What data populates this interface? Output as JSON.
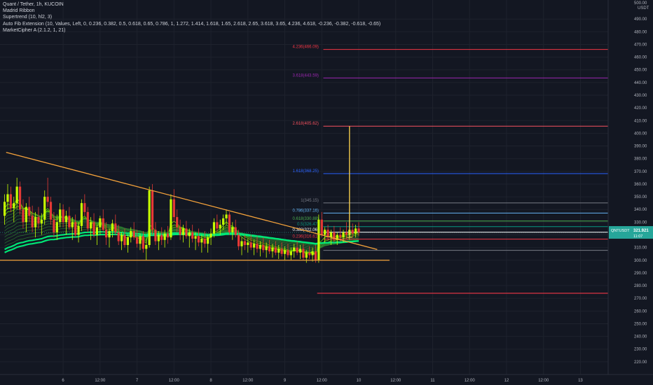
{
  "header": {
    "symbol_line": "Quant / Tether, 1h, KUCOIN",
    "indicators": [
      "Madrid Ribbon",
      "Supertrend (10, hl2, 3)",
      "Auto Fib Extension (10, Values, Left, 0, 0.236, 0.382, 0.5, 0.618, 0.65, 0.786, 1, 1.272, 1.414, 1.618, 1.65, 2.618, 2.65, 3.618, 3.65, 4.236, 4.618, -0.236, -0.382, -0.618, -0.65)",
      "MarketCipher A (2.1.2, 1, 21)"
    ]
  },
  "price_axis": {
    "currency": "USDT",
    "top_label": "500.00",
    "last_price_symbol": "QNTUSDT",
    "last_price": "321.921",
    "countdown": "11:07",
    "last_price_color": "#26a69a"
  },
  "chart_data": {
    "type": "candlestick",
    "ylim": [
      210,
      505
    ],
    "y_ticks": [
      220,
      230,
      240,
      250,
      260,
      270,
      280,
      290,
      300,
      310,
      320,
      330,
      340,
      350,
      360,
      370,
      380,
      390,
      400,
      410,
      420,
      430,
      440,
      450,
      460,
      470,
      480,
      490
    ],
    "x_tick_labels": [
      "6",
      "12:00",
      "7",
      "12:00",
      "8",
      "12:00",
      "9",
      "12:00",
      "10",
      "12:00",
      "11",
      "12:00",
      "12",
      "12:00",
      "13"
    ],
    "x_range_hours": [
      -20.5,
      177
    ],
    "x_ticks_hours": [
      0,
      12,
      24,
      36,
      48,
      60,
      72,
      84,
      96,
      108,
      120,
      132,
      144,
      156,
      168
    ],
    "fib_levels": [
      {
        "ratio": "4.236",
        "price": 466.09,
        "label": "4.236(466.09)",
        "color": "#f23645"
      },
      {
        "ratio": "3.618",
        "price": 443.59,
        "label": "3.618(443.59)",
        "color": "#9c27b0"
      },
      {
        "ratio": "2.618",
        "price": 405.62,
        "label": "2.618(405.62)",
        "color": "#f7525f"
      },
      {
        "ratio": "1.618",
        "price": 368.25,
        "label": "1.618(368.25)",
        "color": "#2962ff"
      },
      {
        "ratio": "1",
        "price": 345.15,
        "label": "1(345.15)",
        "color": "#787b86"
      },
      {
        "ratio": "0.786",
        "price": 337.16,
        "label": "0.786(337.16)",
        "color": "#64b5f6"
      },
      {
        "ratio": "0.618",
        "price": 330.88,
        "label": "0.618(330.88)",
        "color": "#4caf50"
      },
      {
        "ratio": "0.5",
        "price": 326.47,
        "label": "0.5(326.47)",
        "color": "#089981"
      },
      {
        "ratio": "0.382",
        "price": 322.06,
        "label": "0.382(322.06)",
        "color": "#ffffff"
      },
      {
        "ratio": "0.236",
        "price": 316.61,
        "label": "0.236(316.61)",
        "color": "#f23645"
      },
      {
        "ratio": "0",
        "price": 307.8,
        "label": "",
        "color": "#787b86"
      }
    ],
    "support_line": {
      "price": 274,
      "start_hour": 82.5,
      "end_hour": 177,
      "color": "#f23645"
    },
    "trendline_upper": {
      "from": [
        -18.5,
        385
      ],
      "to": [
        102,
        308.5
      ],
      "color": "#f6a33b"
    },
    "trendline_lower": {
      "from": [
        -20.5,
        300
      ],
      "to": [
        106,
        300
      ],
      "color": "#f6a33b"
    },
    "projection_line": {
      "hour": 93,
      "from": 318,
      "to": 405.6,
      "color": "#ffd54f"
    },
    "candles": [
      [
        -19,
        335,
        352,
        328,
        346
      ],
      [
        -18,
        346,
        360,
        340,
        352
      ],
      [
        -17,
        352,
        358,
        338,
        341
      ],
      [
        -16,
        341,
        350,
        330,
        345
      ],
      [
        -15,
        345,
        365,
        340,
        358
      ],
      [
        -14,
        358,
        362,
        336,
        340
      ],
      [
        -13,
        340,
        348,
        325,
        330
      ],
      [
        -12,
        330,
        345,
        322,
        342
      ],
      [
        -11,
        342,
        350,
        330,
        335
      ],
      [
        -10,
        335,
        343,
        322,
        326
      ],
      [
        -9,
        326,
        338,
        318,
        334
      ],
      [
        -8,
        334,
        342,
        325,
        329
      ],
      [
        -7,
        329,
        337,
        320,
        332
      ],
      [
        -6,
        332,
        355,
        328,
        350
      ],
      [
        -5,
        350,
        365,
        342,
        346
      ],
      [
        -4,
        346,
        350,
        328,
        332
      ],
      [
        -3,
        332,
        338,
        318,
        322
      ],
      [
        -2,
        322,
        336,
        316,
        330
      ],
      [
        -1,
        330,
        345,
        326,
        340
      ],
      [
        0,
        340,
        344,
        326,
        330
      ],
      [
        1,
        330,
        339,
        320,
        335
      ],
      [
        2,
        335,
        342,
        324,
        326
      ],
      [
        3,
        326,
        334,
        316,
        330
      ],
      [
        4,
        330,
        336,
        318,
        320
      ],
      [
        5,
        320,
        330,
        314,
        327
      ],
      [
        6,
        327,
        348,
        323,
        345
      ],
      [
        7,
        345,
        352,
        335,
        338
      ],
      [
        8,
        338,
        342,
        322,
        325
      ],
      [
        9,
        325,
        334,
        316,
        330
      ],
      [
        10,
        330,
        337,
        318,
        320
      ],
      [
        11,
        320,
        328,
        312,
        326
      ],
      [
        12,
        326,
        335,
        320,
        333
      ],
      [
        13,
        333,
        340,
        322,
        324
      ],
      [
        14,
        324,
        330,
        312,
        318
      ],
      [
        15,
        318,
        325,
        310,
        323
      ],
      [
        16,
        323,
        332,
        318,
        329
      ],
      [
        17,
        329,
        336,
        320,
        322
      ],
      [
        18,
        322,
        328,
        312,
        315
      ],
      [
        19,
        315,
        322,
        308,
        320
      ],
      [
        20,
        320,
        325,
        310,
        312
      ],
      [
        21,
        312,
        320,
        306,
        318
      ],
      [
        22,
        318,
        326,
        314,
        323
      ],
      [
        23,
        323,
        330,
        316,
        318
      ],
      [
        24,
        318,
        324,
        310,
        313
      ],
      [
        25,
        313,
        321,
        308,
        319
      ],
      [
        26,
        319,
        323,
        306,
        309
      ],
      [
        27,
        309,
        315,
        300,
        312
      ],
      [
        28,
        312,
        358,
        310,
        355
      ],
      [
        29,
        355,
        360,
        320,
        324
      ],
      [
        30,
        324,
        330,
        312,
        315
      ],
      [
        31,
        315,
        323,
        308,
        320
      ],
      [
        32,
        320,
        326,
        312,
        316
      ],
      [
        33,
        316,
        324,
        310,
        321
      ],
      [
        34,
        321,
        327,
        313,
        318
      ],
      [
        35,
        318,
        352,
        316,
        348
      ],
      [
        36,
        348,
        356,
        330,
        334
      ],
      [
        37,
        334,
        340,
        322,
        326
      ],
      [
        38,
        326,
        332,
        316,
        320
      ],
      [
        39,
        320,
        328,
        314,
        325
      ],
      [
        40,
        325,
        331,
        317,
        319
      ],
      [
        41,
        319,
        325,
        310,
        322
      ],
      [
        42,
        322,
        328,
        314,
        317
      ],
      [
        43,
        317,
        322,
        308,
        319
      ],
      [
        44,
        319,
        325,
        311,
        314
      ],
      [
        45,
        314,
        320,
        306,
        317
      ],
      [
        46,
        317,
        323,
        310,
        313
      ],
      [
        47,
        313,
        320,
        306,
        318
      ],
      [
        48,
        318,
        325,
        312,
        321
      ],
      [
        49,
        321,
        333,
        318,
        330
      ],
      [
        50,
        330,
        336,
        322,
        325
      ],
      [
        51,
        325,
        332,
        320,
        328
      ],
      [
        52,
        328,
        336,
        324,
        333
      ],
      [
        53,
        333,
        340,
        328,
        336
      ],
      [
        54,
        336,
        338,
        320,
        322
      ],
      [
        55,
        322,
        330,
        316,
        326
      ],
      [
        56,
        326,
        332,
        318,
        320
      ],
      [
        57,
        320,
        324,
        308,
        311
      ],
      [
        58,
        311,
        318,
        304,
        315
      ],
      [
        59,
        315,
        320,
        308,
        312
      ],
      [
        60,
        312,
        317,
        306,
        314
      ],
      [
        61,
        314,
        320,
        308,
        310
      ],
      [
        62,
        310,
        316,
        304,
        313
      ],
      [
        63,
        313,
        319,
        306,
        309
      ],
      [
        64,
        309,
        315,
        303,
        312
      ],
      [
        65,
        312,
        318,
        306,
        308
      ],
      [
        66,
        308,
        314,
        302,
        311
      ],
      [
        67,
        311,
        316,
        305,
        307
      ],
      [
        68,
        307,
        313,
        302,
        310
      ],
      [
        69,
        310,
        315,
        304,
        306
      ],
      [
        70,
        306,
        312,
        301,
        309
      ],
      [
        71,
        309,
        314,
        303,
        305
      ],
      [
        72,
        305,
        311,
        300,
        308
      ],
      [
        73,
        308,
        313,
        302,
        304
      ],
      [
        74,
        304,
        310,
        300,
        307
      ],
      [
        75,
        307,
        313,
        302,
        310
      ],
      [
        76,
        310,
        315,
        304,
        306
      ],
      [
        77,
        306,
        312,
        301,
        309
      ],
      [
        78,
        309,
        313,
        300,
        302
      ],
      [
        79,
        302,
        308,
        298,
        306
      ],
      [
        80,
        306,
        311,
        301,
        304
      ],
      [
        81,
        304,
        310,
        299,
        307
      ],
      [
        82,
        307,
        312,
        298,
        300
      ],
      [
        83,
        300,
        336,
        298,
        332
      ],
      [
        84,
        332,
        338,
        318,
        320
      ],
      [
        85,
        320,
        326,
        314,
        324
      ],
      [
        86,
        324,
        328,
        316,
        318
      ],
      [
        87,
        318,
        324,
        312,
        322
      ],
      [
        88,
        322,
        327,
        314,
        316
      ],
      [
        89,
        316,
        322,
        312,
        320
      ],
      [
        90,
        320,
        326,
        315,
        318
      ],
      [
        91,
        318,
        324,
        314,
        322
      ],
      [
        92,
        322,
        330,
        317,
        320
      ],
      [
        93,
        320,
        326,
        316,
        324
      ],
      [
        94,
        324,
        329,
        318,
        321
      ],
      [
        95,
        321,
        328,
        318,
        325
      ],
      [
        96,
        325,
        330,
        319,
        322
      ]
    ]
  }
}
